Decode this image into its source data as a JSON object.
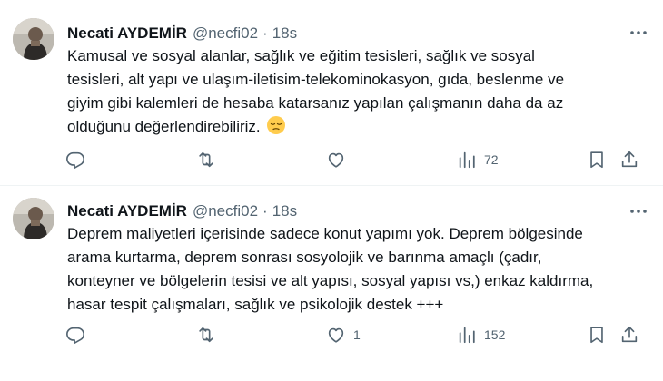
{
  "tweets": [
    {
      "author": {
        "name": "Necati AYDEMİR",
        "handle": "@necfi02"
      },
      "separator": "·",
      "time": "18s",
      "text": "Kamusal ve sosyal alanlar, sağlık ve eğitim tesisleri, sağlık ve sosyal\ntesisleri, alt yapı ve ulaşım-iletisim-telekominokasyon, gıda, beslenme ve\ngiyim gibi kalemleri de hesaba katarsanız yapılan çalışmanın daha da az\nolduğunu değerlendirebiliriz.",
      "emoji": "pensive-face",
      "stats": {
        "replies": "",
        "reposts": "",
        "likes": "",
        "views": "72"
      }
    },
    {
      "author": {
        "name": "Necati AYDEMİR",
        "handle": "@necfi02"
      },
      "separator": "·",
      "time": "18s",
      "text": "Deprem maliyetleri içerisinde sadece konut yapımı yok. Deprem bölgesinde\narama kurtarma, deprem sonrası sosyolojik ve barınma amaçlı (çadır,\nkonteyner ve bölgelerin tesisi ve alt yapısı, sosyal yapısı vs,) enkaz kaldırma,\nhasar tespit çalışmaları, sağlık ve psikolojik destek +++",
      "emoji": "",
      "stats": {
        "replies": "",
        "reposts": "",
        "likes": "1",
        "views": "152"
      }
    }
  ],
  "icons": {
    "reply": "reply-icon",
    "repost": "repost-icon",
    "like": "like-icon",
    "views": "views-icon",
    "bookmark": "bookmark-icon",
    "share": "share-icon",
    "more": "more-icon"
  },
  "colors": {
    "text": "#0f1419",
    "secondary": "#536471",
    "divider": "#eff3f4"
  }
}
